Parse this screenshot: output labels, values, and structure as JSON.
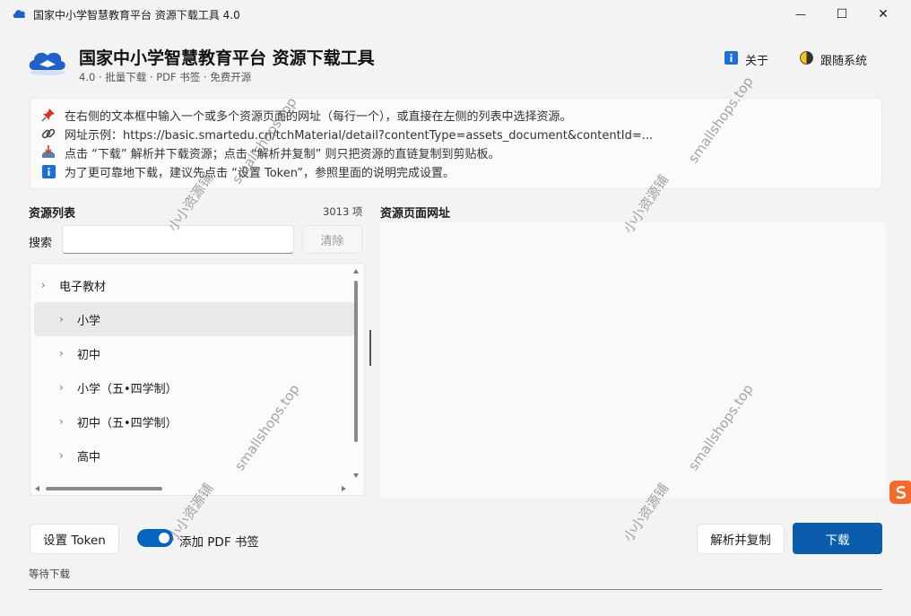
{
  "window": {
    "title": "国家中小学智慧教育平台 资源下载工具 4.0",
    "minimize_glyph": "—",
    "maximize_glyph": "☐",
    "close_glyph": "✕"
  },
  "header": {
    "title": "国家中小学智慧教育平台 资源下载工具",
    "subtitle": "4.0 · 批量下载 · PDF 书签 · 免费开源",
    "about_label": "关于",
    "theme_label": "跟随系统"
  },
  "info": {
    "lines": [
      {
        "icon": "pushpin-icon",
        "text": "在右侧的文本框中输入一个或多个资源页面的网址（每行一个），或直接在左侧的列表中选择资源。"
      },
      {
        "icon": "link-icon",
        "text": "网址示例：https://basic.smartedu.cn/tchMaterial/detail?contentType=assets_document&contentId=..."
      },
      {
        "icon": "inbox-tray-icon",
        "text": "点击 “下载” 解析并下载资源；点击 “解析并复制” 则只把资源的直链复制到剪贴板。"
      },
      {
        "icon": "info-icon",
        "text": "为了更可靠地下载，建议先点击 “设置 Token”，参照里面的说明完成设置。"
      }
    ]
  },
  "resource_list": {
    "title": "资源列表",
    "count": "3013 项",
    "search_label": "搜索",
    "search_value": "",
    "clear_label": "清除",
    "items": [
      {
        "label": "电子教材",
        "level": 0,
        "selected": false
      },
      {
        "label": "小学",
        "level": 1,
        "selected": true
      },
      {
        "label": "初中",
        "level": 1,
        "selected": false
      },
      {
        "label": "小学（五•四学制）",
        "level": 1,
        "selected": false
      },
      {
        "label": "初中（五•四学制）",
        "level": 1,
        "selected": false
      },
      {
        "label": "高中",
        "level": 1,
        "selected": false
      }
    ]
  },
  "url_panel": {
    "title": "资源页面网址",
    "value": ""
  },
  "bottom": {
    "token_label": "设置 Token",
    "pdf_bookmark_label": "添加 PDF 书签",
    "pdf_bookmark_on": true,
    "copy_label": "解析并复制",
    "download_label": "下载",
    "status": "等待下载",
    "progress": 0
  },
  "watermarks": {
    "site": "smallshops.top",
    "shop": "小小资源铺"
  },
  "colors": {
    "accent": "#0b5cad",
    "toggle": "#0563c1",
    "background": "#f3f3f3"
  }
}
